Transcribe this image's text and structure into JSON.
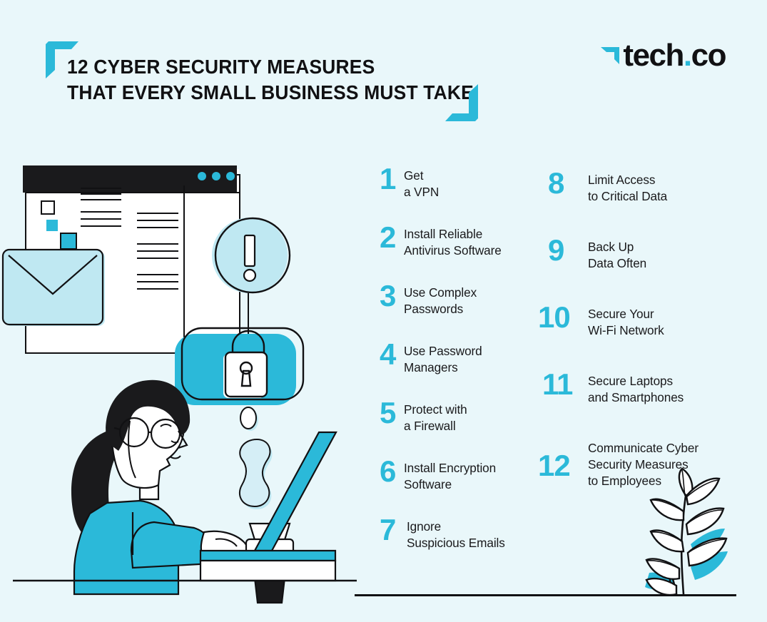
{
  "page": {
    "background_color": "#e9f7fa",
    "accent_color": "#2bb9d9",
    "accent_light_color": "#bfe8f2",
    "ink_color": "#111113"
  },
  "header": {
    "title": "12 CYBER SECURITY MEASURES\nTHAT EVERY SMALL BUSINESS MUST TAKE",
    "corner_bracket_top_left": "corner-bracket",
    "corner_bracket_bottom_right": "corner-bracket"
  },
  "logo": {
    "mark": "tech-co-arrow-mark",
    "text_main": "tech",
    "text_dot": ".",
    "text_suffix": "co"
  },
  "list": {
    "left_column": [
      {
        "number": "1",
        "text": "Get\na VPN"
      },
      {
        "number": "2",
        "text": "Install Reliable\nAntivirus Software"
      },
      {
        "number": "3",
        "text": "Use Complex\nPasswords"
      },
      {
        "number": "4",
        "text": "Use Password\nManagers"
      },
      {
        "number": "5",
        "text": "Protect with\na Firewall"
      },
      {
        "number": "6",
        "text": "Install Encryption\nSoftware"
      },
      {
        "number": "7",
        "text": "Ignore\nSuspicious Emails"
      }
    ],
    "right_column": [
      {
        "number": "8",
        "text": "Limit Access\nto Critical Data"
      },
      {
        "number": "9",
        "text": "Back Up\nData Often"
      },
      {
        "number": "10",
        "text": "Secure Your\nWi-Fi Network"
      },
      {
        "number": "11",
        "text": "Secure Laptops\nand Smartphones"
      },
      {
        "number": "12",
        "text": "Communicate Cyber\nSecurity Measures\nto Employees"
      }
    ]
  },
  "illustration": {
    "browser_window": "browser-window",
    "browser_dots": 3,
    "envelope": "envelope-icon",
    "alert_badge": "exclamation-circle-icon",
    "lock_badge": "padlock-icon",
    "person": "person-at-laptop",
    "coffee_cup": "coffee-cup-icon",
    "steam": "steam-icon",
    "laptop": "laptop-icon",
    "plant": "plant-illustration",
    "ground_line": "ground-line"
  }
}
